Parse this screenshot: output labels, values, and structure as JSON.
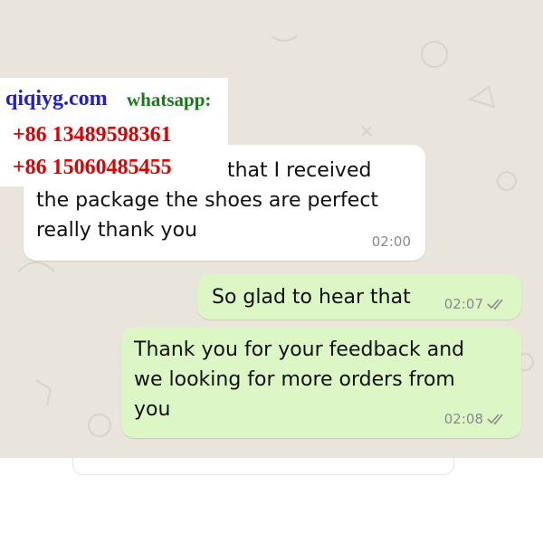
{
  "messages": [
    {
      "direction": "incoming",
      "text_line1": "u that I received",
      "text_rest": "the package the shoes are perfect\nreally thank you",
      "time": "02:00"
    },
    {
      "direction": "outgoing",
      "text": "So glad to hear that",
      "time": "02:07",
      "status": "read-double-check"
    },
    {
      "direction": "outgoing",
      "text": "Thank you for your feedback and\nwe looking for more orders from\nyou",
      "time": "02:08",
      "status": "read-double-check"
    }
  ],
  "watermark": {
    "site": "qiqiyg.com",
    "app": "whatsapp:",
    "phone1": "+86 13489598361",
    "phone2": "+86 15060485455"
  },
  "colors": {
    "wallpaper": "#e9e5dc",
    "incoming_bubble": "#ffffff",
    "outgoing_bubble": "#dcf7c5",
    "watermark_site": "#1f1fd0",
    "watermark_app": "#1a7a1a",
    "watermark_phone": "#e00000"
  }
}
